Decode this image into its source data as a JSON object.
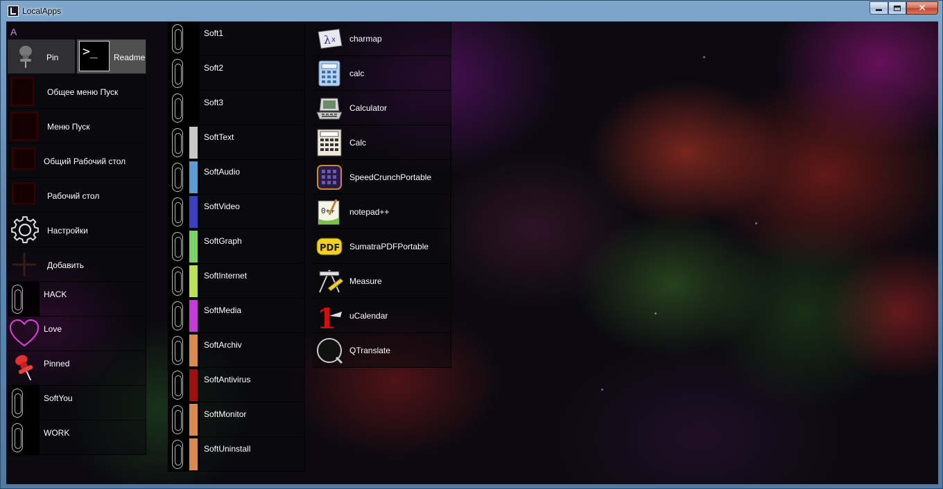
{
  "window": {
    "title": "LocalApps"
  },
  "column1": {
    "letter": "A",
    "pin_label": "Pin",
    "readme_label": "Readme",
    "readme_icon_text": ">_",
    "items": [
      {
        "label": "Общее меню Пуск",
        "icon": "start-menu-common-icon"
      },
      {
        "label": "Меню Пуск",
        "icon": "start-menu-icon"
      },
      {
        "label": "Общий Рабочий стол",
        "icon": "desktop-common-icon"
      },
      {
        "label": "Рабочий стол",
        "icon": "desktop-icon"
      },
      {
        "label": "Настройки",
        "icon": "gear-icon"
      },
      {
        "label": "Добавить",
        "icon": "plus-icon"
      },
      {
        "label": "HACK",
        "icon": "paperclip-icon"
      },
      {
        "label": "Love",
        "icon": "heart-icon"
      },
      {
        "label": "Pinned",
        "icon": "pushpin-icon"
      },
      {
        "label": "SoftYou",
        "icon": "paperclip-icon"
      },
      {
        "label": "WORK",
        "icon": "paperclip-icon"
      }
    ]
  },
  "column2": {
    "items": [
      {
        "label": "Soft1",
        "color": ""
      },
      {
        "label": "Soft2",
        "color": ""
      },
      {
        "label": "Soft3",
        "color": ""
      },
      {
        "label": "SoftText",
        "color": "#c8c8c8"
      },
      {
        "label": "SoftAudio",
        "color": "#5e9bd0"
      },
      {
        "label": "SoftVideo",
        "color": "#3e3ec0"
      },
      {
        "label": "SoftGraph",
        "color": "#7ed06a"
      },
      {
        "label": "SoftInternet",
        "color": "#b8e05a"
      },
      {
        "label": "SoftMedia",
        "color": "#c23cd6"
      },
      {
        "label": "SoftArchiv",
        "color": "#d88a52"
      },
      {
        "label": "SoftAntivirus",
        "color": "#9c1010"
      },
      {
        "label": "SoftMonitor",
        "color": "#d88a52"
      },
      {
        "label": "SoftUninstall",
        "color": "#d88a52"
      }
    ]
  },
  "column3": {
    "items": [
      {
        "label": "charmap",
        "icon": "charmap-icon"
      },
      {
        "label": "calc",
        "icon": "calc-icon"
      },
      {
        "label": "Calculator",
        "icon": "laptop-calculator-icon"
      },
      {
        "label": "Calc",
        "icon": "keypad-calc-icon"
      },
      {
        "label": "SpeedCrunchPortable",
        "icon": "speedcrunch-icon"
      },
      {
        "label": "notepad++",
        "icon": "notepad-icon"
      },
      {
        "label": "SumatraPDFPortable",
        "icon": "pdf-icon"
      },
      {
        "label": "Measure",
        "icon": "measure-icon"
      },
      {
        "label": "uCalendar",
        "icon": "calendar-icon"
      },
      {
        "label": "QTranslate",
        "icon": "qtranslate-icon"
      }
    ]
  }
}
